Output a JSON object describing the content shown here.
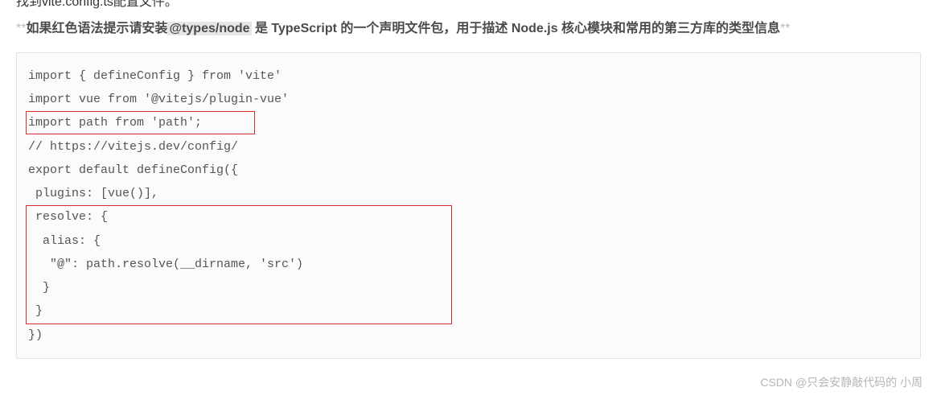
{
  "cutLine": "找到vite.config.ts配置文件。",
  "paragraph": {
    "prefix": "**",
    "part1": "如果红色语法提示请安装",
    "highlighted": "@types/node",
    "part2": " 是 TypeScript 的一个声明文件包，用于描述 Node.js 核心模块和常用的第三方库的类型信息",
    "suffix": "**"
  },
  "code": {
    "lines": [
      "import { defineConfig } from 'vite'",
      "import vue from '@vitejs/plugin-vue'",
      "import path from 'path';",
      "// https://vitejs.dev/config/",
      "export default defineConfig({",
      " plugins: [vue()],",
      " resolve: {",
      "  alias: {",
      "   \"@\": path.resolve(__dirname, 'src')",
      "  }",
      " }",
      "})"
    ]
  },
  "watermark": "CSDN @只会安静敲代码的 小周"
}
